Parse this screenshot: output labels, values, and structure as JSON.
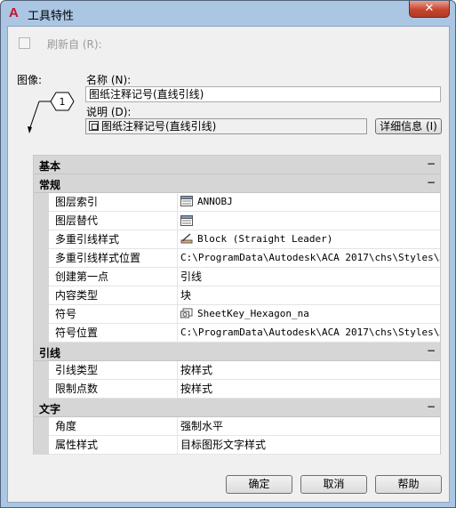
{
  "window": {
    "title": "工具特性",
    "close_glyph": "✕",
    "app_icon": "A"
  },
  "refresh": {
    "label": "刷新自 (R):",
    "checked": false
  },
  "image": {
    "label": "图像:",
    "preview_number": "1"
  },
  "name": {
    "label": "名称 (N):",
    "value": "图纸注释记号(直线引线)"
  },
  "description": {
    "label": "说明 (D):",
    "value": "图纸注释记号(直线引线)",
    "details_button": "详细信息 (I)"
  },
  "grid": {
    "categories": [
      {
        "label": "基本",
        "toggle": "−"
      },
      {
        "label": "常规",
        "toggle": "−"
      },
      {
        "label": "引线",
        "toggle": "−"
      },
      {
        "label": "文字",
        "toggle": "−"
      }
    ],
    "general": [
      {
        "name": "图层索引",
        "value": "ANNOBJ",
        "icon": "layer-list-icon",
        "mono": true
      },
      {
        "name": "图层替代",
        "value": "",
        "icon": "layer-list-icon",
        "mono": false
      },
      {
        "name": "多重引线样式",
        "value": "Block (Straight Leader)",
        "icon": "mleader-style-icon",
        "mono": true
      },
      {
        "name": "多重引线样式位置",
        "value": "C:\\ProgramData\\Autodesk\\ACA  2017\\chs\\Styles\\…",
        "icon": "",
        "mono": true
      },
      {
        "name": "创建第一点",
        "value": "引线",
        "icon": "",
        "mono": false
      },
      {
        "name": "内容类型",
        "value": "块",
        "icon": "",
        "mono": false
      },
      {
        "name": "符号",
        "value": "SheetKey_Hexagon_na",
        "icon": "block-symbol-icon",
        "mono": true
      },
      {
        "name": "符号位置",
        "value": "C:\\ProgramData\\Autodesk\\ACA  2017\\chs\\Styles\\…",
        "icon": "",
        "mono": true
      }
    ],
    "leader": [
      {
        "name": "引线类型",
        "value": "按样式"
      },
      {
        "name": "限制点数",
        "value": "按样式"
      }
    ],
    "text": [
      {
        "name": "角度",
        "value": "强制水平"
      },
      {
        "name": "属性样式",
        "value": "目标图形文字样式"
      }
    ]
  },
  "buttons": {
    "ok": "确定",
    "cancel": "取消",
    "help": "帮助"
  }
}
